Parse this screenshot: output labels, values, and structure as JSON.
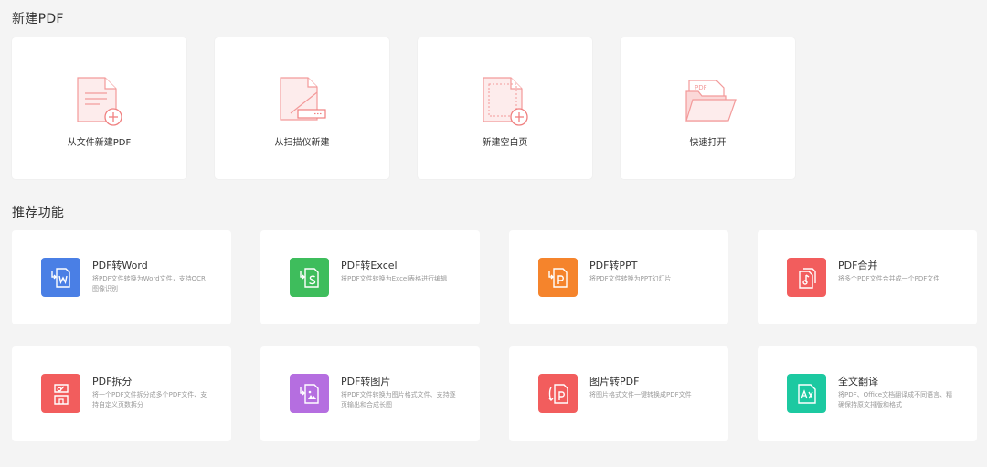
{
  "sections": {
    "new_title": "新建PDF",
    "recommend_title": "推荐功能"
  },
  "new_cards": [
    {
      "label": "从文件新建PDF",
      "icon": "new-from-file-icon"
    },
    {
      "label": "从扫描仪新建",
      "icon": "scanner-icon"
    },
    {
      "label": "新建空白页",
      "icon": "blank-page-icon"
    },
    {
      "label": "快速打开",
      "icon": "open-folder-icon"
    }
  ],
  "features": [
    {
      "title": "PDF转Word",
      "desc": "将PDF文件转换为Word文件，支持OCR图像识别",
      "color": "#4a7fe5",
      "icon": "word-icon"
    },
    {
      "title": "PDF转Excel",
      "desc": "将PDF文件转换为Excel表格进行编辑",
      "color": "#3ebd5c",
      "icon": "excel-icon"
    },
    {
      "title": "PDF转PPT",
      "desc": "将PDF文件转换为PPT幻灯片",
      "color": "#f5842c",
      "icon": "ppt-icon"
    },
    {
      "title": "PDF合并",
      "desc": "将多个PDF文件合并成一个PDF文件",
      "color": "#f25d5d",
      "icon": "merge-icon"
    },
    {
      "title": "PDF拆分",
      "desc": "将一个PDF文件拆分成多个PDF文件、支持自定义页数拆分",
      "color": "#f25d5d",
      "icon": "split-icon"
    },
    {
      "title": "PDF转图片",
      "desc": "将PDF文件转换为图片格式文件、支持逐页输出和合成长图",
      "color": "#b56ee0",
      "icon": "image-icon"
    },
    {
      "title": "图片转PDF",
      "desc": "将图片格式文件一键转换成PDF文件",
      "color": "#f25d5d",
      "icon": "image-to-pdf-icon"
    },
    {
      "title": "全文翻译",
      "desc": "将PDF、Office文档翻译成不同语言、精确保持原文排版和格式",
      "color": "#1cc9a1",
      "icon": "translate-icon"
    }
  ],
  "illus_text": {
    "pdf_tag": "PDF"
  }
}
